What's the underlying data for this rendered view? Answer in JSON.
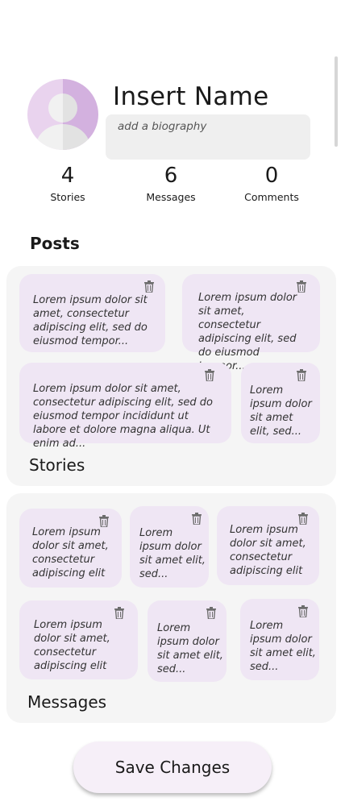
{
  "profile": {
    "name": "Insert Name",
    "bio_placeholder": "add a biography"
  },
  "stats": [
    {
      "value": "4",
      "label": "Stories"
    },
    {
      "value": "6",
      "label": "Messages"
    },
    {
      "value": "0",
      "label": "Comments"
    }
  ],
  "posts": {
    "heading": "Posts",
    "stories_panel": {
      "title": "Stories",
      "cards": [
        {
          "text": "Lorem ipsum dolor sit amet, consectetur adipiscing elit, sed do eiusmod tempor...",
          "icon": "trash-icon"
        },
        {
          "text": "Lorem ipsum dolor sit amet, consectetur adipiscing elit, sed do eiusmod tempor...",
          "icon": "trash-icon"
        },
        {
          "text": "Lorem ipsum dolor sit amet, consectetur adipiscing elit, sed do eiusmod tempor incididunt ut labore et dolore magna aliqua. Ut enim ad...",
          "icon": "trash-icon"
        },
        {
          "text": "Lorem ipsum dolor sit amet elit, sed...",
          "icon": "trash-icon"
        }
      ]
    },
    "messages_panel": {
      "title": "Messages",
      "cards": [
        {
          "text": "Lorem ipsum dolor sit amet, consectetur adipiscing elit",
          "icon": "trash-icon"
        },
        {
          "text": "Lorem ipsum dolor sit amet elit, sed...",
          "icon": "trash-icon"
        },
        {
          "text": "Lorem ipsum dolor sit amet, consectetur adipiscing elit",
          "icon": "trash-icon"
        },
        {
          "text": "Lorem ipsum dolor sit amet, consectetur adipiscing elit",
          "icon": "trash-icon"
        },
        {
          "text": "Lorem ipsum dolor sit amet elit, sed...",
          "icon": "trash-icon"
        },
        {
          "text": "Lorem ipsum dolor sit amet elit, sed...",
          "icon": "trash-icon"
        }
      ]
    }
  },
  "actions": {
    "save_label": "Save Changes"
  },
  "colors": {
    "card": "#efe6f4",
    "panel": "#f5f5f5",
    "button": "#f6eff8",
    "avatar_accent": "#d3b1df"
  }
}
